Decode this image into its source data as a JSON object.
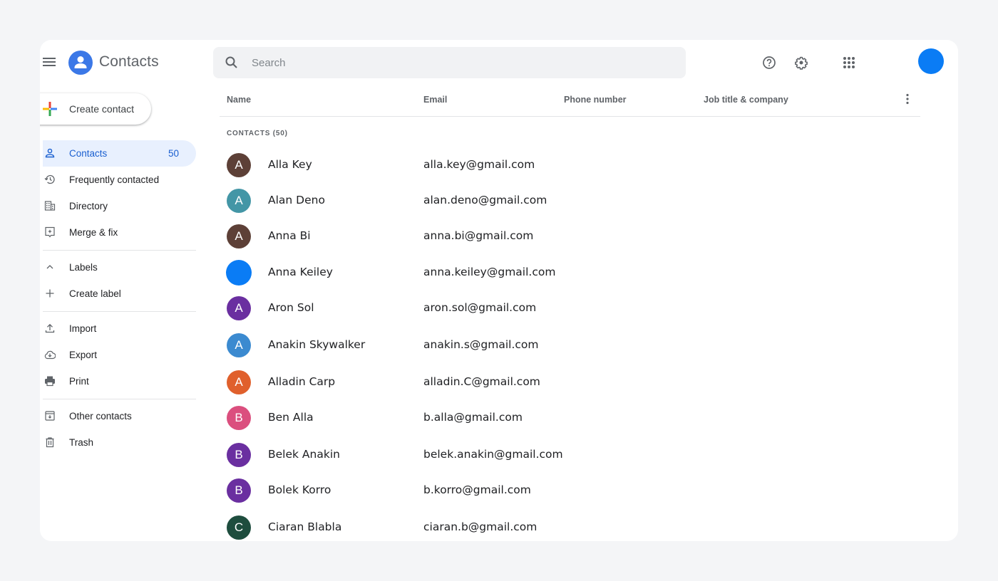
{
  "app": {
    "title": "Contacts"
  },
  "search": {
    "placeholder": "Search",
    "value": ""
  },
  "header_icons": [
    "menu-icon",
    "help-icon",
    "settings-icon",
    "apps-grid-icon"
  ],
  "profile": {
    "avatar_color": "#0a7cf5"
  },
  "create_contact": {
    "label": "Create contact"
  },
  "sidebar": {
    "items": [
      {
        "label": "Contacts",
        "count": "50",
        "icon": "person-icon",
        "active": true
      },
      {
        "label": "Frequently contacted",
        "icon": "history-icon"
      },
      {
        "label": "Directory",
        "icon": "building-icon"
      },
      {
        "label": "Merge & fix",
        "icon": "merge-fix-icon"
      },
      {
        "label": "Labels",
        "icon": "chevron-up-icon"
      },
      {
        "label": "Create label",
        "icon": "plus-icon"
      },
      {
        "label": "Import",
        "icon": "upload-icon"
      },
      {
        "label": "Export",
        "icon": "cloud-download-icon"
      },
      {
        "label": "Print",
        "icon": "printer-icon"
      },
      {
        "label": "Other contacts",
        "icon": "archive-icon"
      },
      {
        "label": "Trash",
        "icon": "trash-icon"
      }
    ]
  },
  "table": {
    "columns": [
      "Name",
      "Email",
      "Phone number",
      "Job title & company"
    ],
    "section_label": "CONTACTS (50)",
    "rows": [
      {
        "initial": "A",
        "name": "Alla Key",
        "email": "alla.key@gmail.com",
        "color": "#5d4037"
      },
      {
        "initial": "A",
        "name": "Alan Deno",
        "email": "alan.deno@gmail.com",
        "color": "#4396a6"
      },
      {
        "initial": "A",
        "name": "Anna Bi",
        "email": "anna.bi@gmail.com",
        "color": "#5d4037"
      },
      {
        "initial": "",
        "name": "Anna Keiley",
        "email": "anna.keiley@gmail.com",
        "color": "#0a7cf5"
      },
      {
        "initial": "A",
        "name": "Aron Sol",
        "email": "aron.sol@gmail.com",
        "color": "#6a2fa0"
      },
      {
        "initial": "A",
        "name": "Anakin Skywalker",
        "email": "anakin.s@gmail.com",
        "color": "#3b8ad0"
      },
      {
        "initial": "A",
        "name": "Alladin Carp",
        "email": "alladin.C@gmail.com",
        "color": "#e0602c"
      },
      {
        "initial": "B",
        "name": "Ben Alla",
        "email": "b.alla@gmail.com",
        "color": "#db4f7e"
      },
      {
        "initial": "B",
        "name": "Belek Anakin",
        "email": "belek.anakin@gmail.com",
        "color": "#6a2fa0"
      },
      {
        "initial": "B",
        "name": "Bolek Korro",
        "email": "b.korro@gmail.com",
        "color": "#6a2fa0"
      },
      {
        "initial": "C",
        "name": "Ciaran Blabla",
        "email": "ciaran.b@gmail.com",
        "color": "#1e4d3e"
      }
    ]
  }
}
